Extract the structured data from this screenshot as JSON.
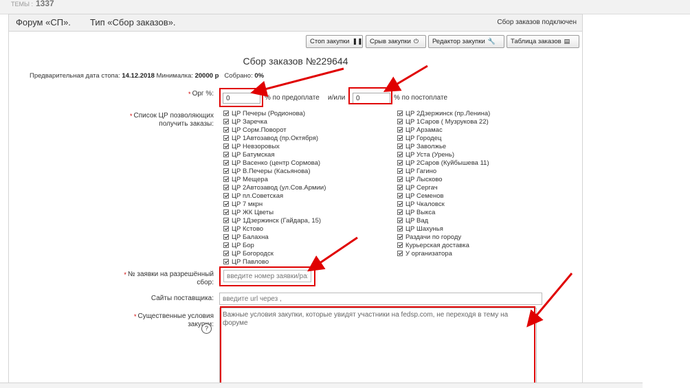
{
  "top": {
    "label": "ТЕМЫ :",
    "number": "1337"
  },
  "header": {
    "forum": "Форум «СП».",
    "type": "Тип «Сбор заказов».",
    "status": "Сбор заказов подключен"
  },
  "toolbar": {
    "stop": "Стоп закупки",
    "abort": "Срыв закупки",
    "editor": "Редактор закупки",
    "table": "Таблица заказов"
  },
  "form": {
    "title": "Сбор заказов №229644",
    "summary": {
      "stop_label": "Предварительная дата стопа:",
      "stop_value": "14.12.2018",
      "min_label": "Минималка:",
      "min_value": "20000 р",
      "collected_label": "Собрано:",
      "collected_value": "0%"
    },
    "org": {
      "label": "Орг %:",
      "prepay_value": "0",
      "prepay_text": "% по предоплате",
      "or_text": "и/или",
      "postpay_value": "0",
      "postpay_text": "% по постоплате"
    },
    "points": {
      "label": "Список ЦР позволяющих получить заказы:",
      "left": [
        "ЦР Печеры (Родионова)",
        "ЦР Заречка",
        "ЦР Сорм.Поворот",
        "ЦР 1Автозавод (пр.Октября)",
        "ЦР Невзоровых",
        "ЦР Батумская",
        "ЦР Васенко (центр Сормова)",
        "ЦР В.Печеры (Касьянова)",
        "ЦР Мещера",
        "ЦР 2Автозавод (ул.Сов.Армии)",
        "ЦР пл.Советская",
        "ЦР 7 мкрн",
        "ЦР ЖК Цветы",
        "ЦР 1Дзержинск (Гайдара, 15)",
        "ЦР Кстово",
        "ЦР Балахна",
        "ЦР Бор",
        "ЦР Богородск",
        "ЦР Павлово"
      ],
      "right": [
        "ЦР 2Дзержинск (пр.Ленина)",
        "ЦР 1Саров ( Музрукова 22)",
        "ЦР Арзамас",
        "ЦР Городец",
        "ЦР Заволжье",
        "ЦР Уста (Урень)",
        "ЦР 2Саров (Куйбышева 11)",
        "ЦР Гагино",
        "ЦР Лысково",
        "ЦР Сергач",
        "ЦР Семенов",
        "ЦР Чкаловск",
        "ЦР Выкса",
        "ЦР Вад",
        "ЦР Шахунья",
        "Раздачи по городу",
        "Курьерская доставка",
        "У организатора"
      ]
    },
    "request": {
      "label": "№ заявки на разрешённый сбор:",
      "placeholder": "введите номер заявки/ра:"
    },
    "sites": {
      "label": "Сайты поставщика:",
      "placeholder": "введите url через ,"
    },
    "conditions": {
      "label": "Существенные условия закупки:",
      "help": "?",
      "placeholder": "Важные условия закупки, которые увидят участники на fedsp.com, не переходя в тему на форуме"
    }
  },
  "colors": {
    "accent_red": "#e00000",
    "header_bg": "#f1f1f1"
  }
}
